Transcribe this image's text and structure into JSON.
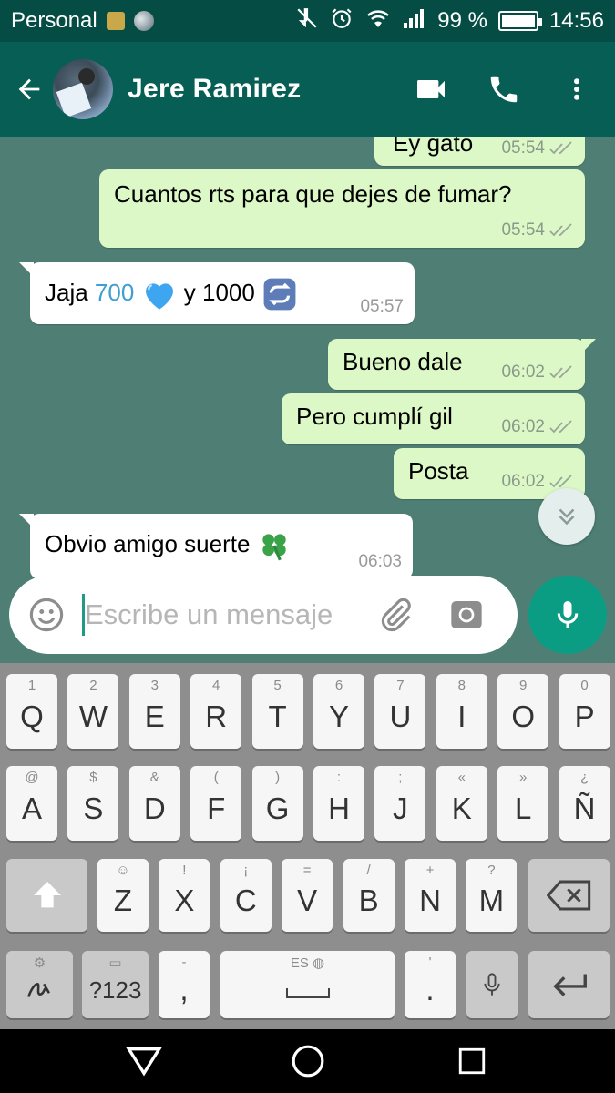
{
  "status_bar": {
    "carrier": "Personal",
    "battery": "99 %",
    "battery_level": 0.99,
    "time": "14:56"
  },
  "header": {
    "contact_name": "Jere Ramirez"
  },
  "messages": [
    {
      "direction": "out",
      "text": "Ey gato",
      "time": "05:54"
    },
    {
      "direction": "out",
      "text": "Cuantos rts para que dejes de fumar?",
      "time": "05:54"
    },
    {
      "direction": "in",
      "text_a": "Jaja ",
      "text_b": "700",
      "text_c": " y 1000",
      "time": "05:57"
    },
    {
      "direction": "out",
      "text": "Bueno dale",
      "time": "06:02"
    },
    {
      "direction": "out",
      "text": "Pero cumplí gil",
      "time": "06:02"
    },
    {
      "direction": "out",
      "text": "Posta",
      "time": "06:02"
    },
    {
      "direction": "in",
      "text": "Obvio amigo suerte",
      "time": "06:03"
    }
  ],
  "composer": {
    "placeholder": "Escribe un mensaje"
  },
  "keyboard": {
    "row1": [
      {
        "main": "Q",
        "hint": "1"
      },
      {
        "main": "W",
        "hint": "2"
      },
      {
        "main": "E",
        "hint": "3"
      },
      {
        "main": "R",
        "hint": "4"
      },
      {
        "main": "T",
        "hint": "5"
      },
      {
        "main": "Y",
        "hint": "6"
      },
      {
        "main": "U",
        "hint": "7"
      },
      {
        "main": "I",
        "hint": "8"
      },
      {
        "main": "O",
        "hint": "9"
      },
      {
        "main": "P",
        "hint": "0"
      }
    ],
    "row2": [
      {
        "main": "A",
        "hint": "@"
      },
      {
        "main": "S",
        "hint": "$"
      },
      {
        "main": "D",
        "hint": "&"
      },
      {
        "main": "F",
        "hint": "("
      },
      {
        "main": "G",
        "hint": ")"
      },
      {
        "main": "H",
        "hint": ":"
      },
      {
        "main": "J",
        "hint": ";"
      },
      {
        "main": "K",
        "hint": "«"
      },
      {
        "main": "L",
        "hint": "»"
      },
      {
        "main": "Ñ",
        "hint": "¿"
      }
    ],
    "row3": [
      {
        "main": "Z",
        "hint": "☺"
      },
      {
        "main": "X",
        "hint": "!"
      },
      {
        "main": "C",
        "hint": "¡"
      },
      {
        "main": "V",
        "hint": "="
      },
      {
        "main": "B",
        "hint": "/"
      },
      {
        "main": "N",
        "hint": "+"
      },
      {
        "main": "M",
        "hint": "?"
      }
    ],
    "symbols_label": "?123",
    "comma_label": ",",
    "comma_hint": "-",
    "space_hint": "ES",
    "period_label": ".",
    "period_hint": "'"
  },
  "colors": {
    "status_bar": "#054d44",
    "app_bar": "#075e54",
    "chat_bg": "#4f7f74",
    "outgoing_bubble": "#dcf8c6",
    "incoming_bubble": "#ffffff",
    "mic_button": "#0b9d84",
    "link": "#3f9fd3"
  },
  "icons": {
    "status": [
      "sim-icon",
      "globe-icon",
      "mute-icon",
      "alarm-icon",
      "wifi-icon",
      "signal-icon",
      "battery-icon"
    ],
    "header": [
      "back-arrow-icon",
      "video-call-icon",
      "phone-icon",
      "more-vert-icon"
    ],
    "composer": [
      "emoji-icon",
      "attach-icon",
      "camera-icon",
      "mic-icon"
    ]
  }
}
